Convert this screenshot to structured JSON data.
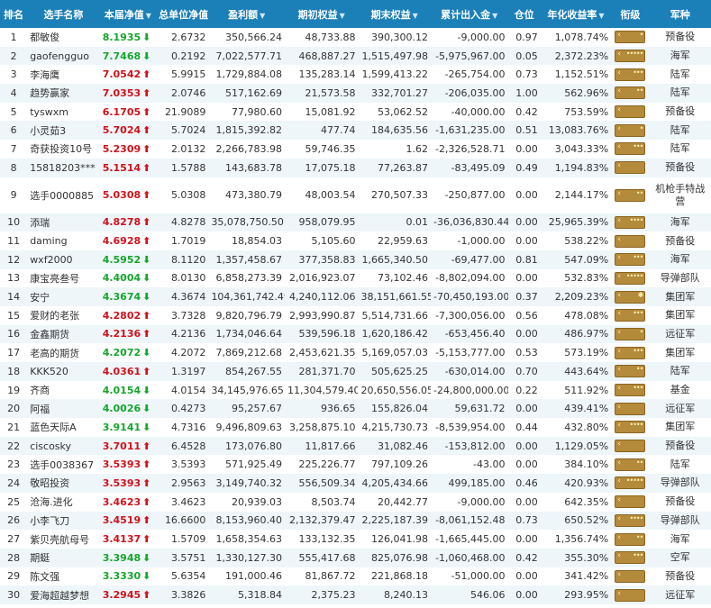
{
  "headers": {
    "rank": "排名",
    "name": "选手名称",
    "nav": "本届净值",
    "unit_nav": "总单位净值",
    "profit": "盈利额",
    "start_equity": "期初权益",
    "end_equity": "期末权益",
    "net_flow": "累计出入金",
    "position": "仓位",
    "annual_return": "年化收益率",
    "title": "衔级",
    "branch": "军种"
  },
  "rows": [
    {
      "rank": "1",
      "name": "都敏俊",
      "nav": "8.1935",
      "dir": "down",
      "unit_nav": "2.6732",
      "profit": "350,566.24",
      "start": "48,733.88",
      "end": "390,300.12",
      "flow": "-9,000.00",
      "pos": "0.97",
      "annual": "1,078.74%",
      "stars": "•",
      "branch": "预备役"
    },
    {
      "rank": "2",
      "name": "gaofengguo",
      "nav": "7.7468",
      "dir": "down",
      "unit_nav": "0.2192",
      "profit": "7,022,577.71",
      "start": "468,887.27",
      "end": "1,515,497.98",
      "flow": "-5,975,967.00",
      "pos": "0.05",
      "annual": "2,372.23%",
      "stars": "•••••",
      "branch": "海军"
    },
    {
      "rank": "3",
      "name": "李海鹰",
      "nav": "7.0542",
      "dir": "up",
      "unit_nav": "5.9915",
      "profit": "1,729,884.08",
      "start": "135,283.14",
      "end": "1,599,413.22",
      "flow": "-265,754.00",
      "pos": "0.73",
      "annual": "1,152.51%",
      "stars": "•••",
      "branch": "陆军"
    },
    {
      "rank": "4",
      "name": "趋势赢家",
      "nav": "7.0353",
      "dir": "up",
      "unit_nav": "2.0746",
      "profit": "517,162.69",
      "start": "21,573.58",
      "end": "332,701.27",
      "flow": "-206,035.00",
      "pos": "1.00",
      "annual": "562.96%",
      "stars": "••",
      "branch": "陆军"
    },
    {
      "rank": "5",
      "name": "tyswxm",
      "nav": "6.1705",
      "dir": "up",
      "unit_nav": "21.9089",
      "profit": "77,980.60",
      "start": "15,081.92",
      "end": "53,062.52",
      "flow": "-40,000.00",
      "pos": "0.42",
      "annual": "753.59%",
      "stars": "",
      "branch": "预备役"
    },
    {
      "rank": "6",
      "name": "小灵茹3",
      "nav": "5.7024",
      "dir": "up",
      "unit_nav": "5.7024",
      "profit": "1,815,392.82",
      "start": "477.74",
      "end": "184,635.56",
      "flow": "-1,631,235.00",
      "pos": "0.51",
      "annual": "13,083.76%",
      "stars": "•",
      "branch": "陆军"
    },
    {
      "rank": "7",
      "name": "奇获投资10号",
      "nav": "5.2309",
      "dir": "up",
      "unit_nav": "2.0132",
      "profit": "2,266,783.98",
      "start": "59,746.35",
      "end": "1.62",
      "flow": "-2,326,528.71",
      "pos": "0.00",
      "annual": "3,043.33%",
      "stars": "•••",
      "branch": "陆军"
    },
    {
      "rank": "8",
      "name": "15818203***",
      "nav": "5.1514",
      "dir": "up",
      "unit_nav": "1.5788",
      "profit": "143,683.78",
      "start": "17,075.18",
      "end": "77,263.87",
      "flow": "-83,495.09",
      "pos": "0.49",
      "annual": "1,194.83%",
      "stars": "",
      "branch": "预备役"
    },
    {
      "rank": "9",
      "name": "选手0000885",
      "nav": "5.0308",
      "dir": "up",
      "unit_nav": "5.0308",
      "profit": "473,380.79",
      "start": "48,003.54",
      "end": "270,507.33",
      "flow": "-250,877.00",
      "pos": "0.00",
      "annual": "2,144.17%",
      "stars": "••",
      "branch": "机枪手特战营",
      "tall": true
    },
    {
      "rank": "10",
      "name": "添瑞",
      "nav": "4.8278",
      "dir": "up",
      "unit_nav": "4.8278",
      "profit": "35,078,750.50",
      "start": "958,079.95",
      "end": "0.01",
      "flow": "-36,036,830.44",
      "pos": "0.00",
      "annual": "25,965.39%",
      "stars": "••••",
      "branch": "海军"
    },
    {
      "rank": "11",
      "name": "daming",
      "nav": "4.6928",
      "dir": "up",
      "unit_nav": "1.7019",
      "profit": "18,854.03",
      "start": "5,105.60",
      "end": "22,959.63",
      "flow": "-1,000.00",
      "pos": "0.00",
      "annual": "538.22%",
      "stars": "",
      "branch": "预备役"
    },
    {
      "rank": "12",
      "name": "wxf2000",
      "nav": "4.5952",
      "dir": "down",
      "unit_nav": "8.1120",
      "profit": "1,357,458.67",
      "start": "377,358.83",
      "end": "1,665,340.50",
      "flow": "-69,477.00",
      "pos": "0.81",
      "annual": "547.09%",
      "stars": "•••",
      "branch": "海军"
    },
    {
      "rank": "13",
      "name": "康宝亮叁号",
      "nav": "4.4004",
      "dir": "down",
      "unit_nav": "8.0130",
      "profit": "6,858,273.39",
      "start": "2,016,923.07",
      "end": "73,102.46",
      "flow": "-8,802,094.00",
      "pos": "0.00",
      "annual": "532.83%",
      "stars": "•••••",
      "branch": "导弹部队"
    },
    {
      "rank": "14",
      "name": "安宁",
      "nav": "4.3674",
      "dir": "down",
      "unit_nav": "4.3674",
      "profit": "104,361,742.49",
      "start": "4,240,112.06",
      "end": "38,151,661.55",
      "flow": "-70,450,193.00",
      "pos": "0.37",
      "annual": "2,209.23%",
      "stars": "✱",
      "branch": "集团军"
    },
    {
      "rank": "15",
      "name": "爱财的老张",
      "nav": "4.2802",
      "dir": "up",
      "unit_nav": "3.7328",
      "profit": "9,820,796.79",
      "start": "2,993,990.87",
      "end": "5,514,731.66",
      "flow": "-7,300,056.00",
      "pos": "0.56",
      "annual": "478.08%",
      "stars": "•••",
      "branch": "集团军"
    },
    {
      "rank": "16",
      "name": "金鑫期货",
      "nav": "4.2136",
      "dir": "up",
      "unit_nav": "4.2136",
      "profit": "1,734,046.64",
      "start": "539,596.18",
      "end": "1,620,186.42",
      "flow": "-653,456.40",
      "pos": "0.00",
      "annual": "486.97%",
      "stars": "•",
      "branch": "远征军"
    },
    {
      "rank": "17",
      "name": "老高的期货",
      "nav": "4.2072",
      "dir": "down",
      "unit_nav": "4.2072",
      "profit": "7,869,212.68",
      "start": "2,453,621.35",
      "end": "5,169,057.03",
      "flow": "-5,153,777.00",
      "pos": "0.53",
      "annual": "573.19%",
      "stars": "•••",
      "branch": "集团军"
    },
    {
      "rank": "18",
      "name": "KKK520",
      "nav": "4.0361",
      "dir": "up",
      "unit_nav": "1.3197",
      "profit": "854,267.55",
      "start": "281,371.70",
      "end": "505,625.25",
      "flow": "-630,014.00",
      "pos": "0.70",
      "annual": "443.64%",
      "stars": "••",
      "branch": "陆军"
    },
    {
      "rank": "19",
      "name": "齐商",
      "nav": "4.0154",
      "dir": "down",
      "unit_nav": "4.0154",
      "profit": "34,145,976.65",
      "start": "11,304,579.40",
      "end": "20,650,556.05",
      "flow": "-24,800,000.00",
      "pos": "0.22",
      "annual": "511.92%",
      "stars": "•••",
      "branch": "基金"
    },
    {
      "rank": "20",
      "name": "阿福",
      "nav": "4.0026",
      "dir": "down",
      "unit_nav": "0.4273",
      "profit": "95,257.67",
      "start": "936.65",
      "end": "155,826.04",
      "flow": "59,631.72",
      "pos": "0.00",
      "annual": "439.41%",
      "stars": "",
      "branch": "远征军"
    },
    {
      "rank": "21",
      "name": "蓝色天际A",
      "nav": "3.9141",
      "dir": "down",
      "unit_nav": "4.7316",
      "profit": "9,496,809.63",
      "start": "3,258,875.10",
      "end": "4,215,730.73",
      "flow": "-8,539,954.00",
      "pos": "0.44",
      "annual": "432.80%",
      "stars": "••••",
      "branch": "集团军"
    },
    {
      "rank": "22",
      "name": "ciscosky",
      "nav": "3.7011",
      "dir": "up",
      "unit_nav": "6.4528",
      "profit": "173,076.80",
      "start": "11,817.66",
      "end": "31,082.46",
      "flow": "-153,812.00",
      "pos": "0.00",
      "annual": "1,129.05%",
      "stars": "",
      "branch": "预备役"
    },
    {
      "rank": "23",
      "name": "选手0038367",
      "nav": "3.5393",
      "dir": "up",
      "unit_nav": "3.5393",
      "profit": "571,925.49",
      "start": "225,226.77",
      "end": "797,109.26",
      "flow": "-43.00",
      "pos": "0.00",
      "annual": "384.10%",
      "stars": "••",
      "branch": "陆军"
    },
    {
      "rank": "24",
      "name": "敬昭投资",
      "nav": "3.5393",
      "dir": "up",
      "unit_nav": "2.9563",
      "profit": "3,149,740.32",
      "start": "556,509.34",
      "end": "4,205,434.66",
      "flow": "499,185.00",
      "pos": "0.46",
      "annual": "420.93%",
      "stars": "•••••",
      "branch": "导弹部队"
    },
    {
      "rank": "25",
      "name": "沧海.进化",
      "nav": "3.4623",
      "dir": "up",
      "unit_nav": "3.4623",
      "profit": "20,939.03",
      "start": "8,503.74",
      "end": "20,442.77",
      "flow": "-9,000.00",
      "pos": "0.00",
      "annual": "642.35%",
      "stars": "",
      "branch": "预备役"
    },
    {
      "rank": "26",
      "name": "小李飞刀",
      "nav": "3.4519",
      "dir": "up",
      "unit_nav": "16.6600",
      "profit": "8,153,960.40",
      "start": "2,132,379.47",
      "end": "2,225,187.39",
      "flow": "-8,061,152.48",
      "pos": "0.73",
      "annual": "650.52%",
      "stars": "••••",
      "branch": "导弹部队"
    },
    {
      "rank": "27",
      "name": "紫贝壳航母号",
      "nav": "3.4137",
      "dir": "up",
      "unit_nav": "1.5709",
      "profit": "1,658,354.63",
      "start": "133,132.35",
      "end": "126,041.98",
      "flow": "-1,665,445.00",
      "pos": "0.00",
      "annual": "1,356.74%",
      "stars": "••",
      "branch": "海军"
    },
    {
      "rank": "28",
      "name": "期蜓",
      "nav": "3.3948",
      "dir": "down",
      "unit_nav": "3.5751",
      "profit": "1,330,127.30",
      "start": "555,417.68",
      "end": "825,076.98",
      "flow": "-1,060,468.00",
      "pos": "0.42",
      "annual": "355.30%",
      "stars": "•••",
      "branch": "空军"
    },
    {
      "rank": "29",
      "name": "陈文强",
      "nav": "3.3330",
      "dir": "down",
      "unit_nav": "5.6354",
      "profit": "191,000.46",
      "start": "81,867.72",
      "end": "221,868.18",
      "flow": "-51,000.00",
      "pos": "0.00",
      "annual": "341.42%",
      "stars": "",
      "branch": "预备役"
    },
    {
      "rank": "30",
      "name": "爱海超越梦想",
      "nav": "3.2945",
      "dir": "up",
      "unit_nav": "3.3826",
      "profit": "5,318.84",
      "start": "2,375.23",
      "end": "8,240.13",
      "flow": "546.06",
      "pos": "0.00",
      "annual": "293.95%",
      "stars": "",
      "branch": "远征军"
    }
  ],
  "icons": {
    "up": "arrow-up-icon",
    "down": "arrow-down-icon",
    "sort": "sort-desc-icon",
    "rank_badge": "rank-badge-icon"
  },
  "colors": {
    "header_bg": "#1b7fb8",
    "up": "#d0121b",
    "down": "#17a52d",
    "badge": "#b48a3b"
  }
}
